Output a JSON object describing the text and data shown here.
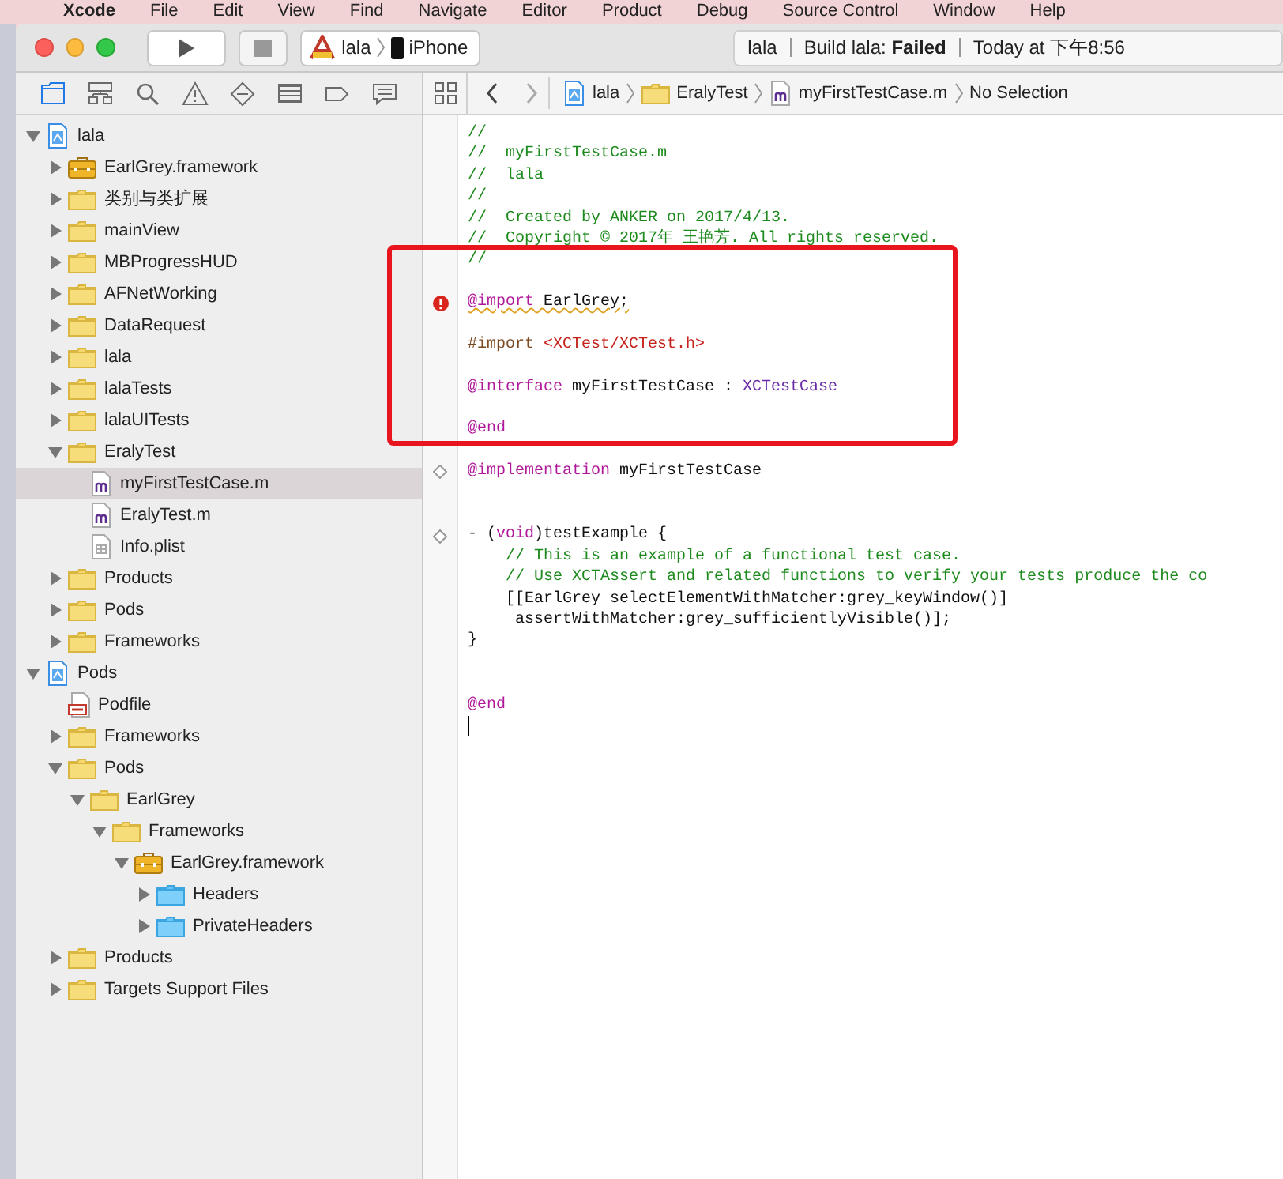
{
  "menu_bar": {
    "items": [
      "Xcode",
      "File",
      "Edit",
      "View",
      "Find",
      "Navigate",
      "Editor",
      "Product",
      "Debug",
      "Source Control",
      "Window",
      "Help"
    ]
  },
  "toolbar": {
    "scheme": {
      "target": "lala",
      "device": "iPhone"
    },
    "activity": {
      "project": "lala",
      "status_label": "Build lala: ",
      "status": "Failed",
      "time": "Today at 下午8:56"
    }
  },
  "navigator_tabs": [
    {
      "kind": "project",
      "selected": true
    },
    {
      "kind": "symbol",
      "selected": false
    },
    {
      "kind": "find",
      "selected": false
    },
    {
      "kind": "issue",
      "selected": false
    },
    {
      "kind": "test",
      "selected": false
    },
    {
      "kind": "debug",
      "selected": false
    },
    {
      "kind": "breakpoint",
      "selected": false
    },
    {
      "kind": "report",
      "selected": false
    }
  ],
  "tree": [
    {
      "label": "lala",
      "kind": "project",
      "expanded": true,
      "selected": false,
      "children": [
        {
          "label": "EarlGrey.framework",
          "kind": "framework",
          "expanded": false,
          "selected": false
        },
        {
          "label": "类别与类扩展",
          "kind": "folder",
          "expanded": false,
          "selected": false
        },
        {
          "label": "mainView",
          "kind": "folder",
          "expanded": false,
          "selected": false
        },
        {
          "label": "MBProgressHUD",
          "kind": "folder",
          "expanded": false,
          "selected": false
        },
        {
          "label": "AFNetWorking",
          "kind": "folder",
          "expanded": false,
          "selected": false
        },
        {
          "label": "DataRequest",
          "kind": "folder",
          "expanded": false,
          "selected": false
        },
        {
          "label": "lala",
          "kind": "folder",
          "expanded": false,
          "selected": false
        },
        {
          "label": "lalaTests",
          "kind": "folder",
          "expanded": false,
          "selected": false
        },
        {
          "label": "lalaUITests",
          "kind": "folder",
          "expanded": false,
          "selected": false
        },
        {
          "label": "EralyTest",
          "kind": "folder",
          "expanded": true,
          "selected": false,
          "children": [
            {
              "label": "myFirstTestCase.m",
              "kind": "m",
              "selected": true
            },
            {
              "label": "EralyTest.m",
              "kind": "m",
              "selected": false
            },
            {
              "label": "Info.plist",
              "kind": "plist",
              "selected": false
            }
          ]
        },
        {
          "label": "Products",
          "kind": "folder",
          "expanded": false,
          "selected": false
        },
        {
          "label": "Pods",
          "kind": "folder",
          "expanded": false,
          "selected": false
        },
        {
          "label": "Frameworks",
          "kind": "folder",
          "expanded": false,
          "selected": false
        }
      ]
    },
    {
      "label": "Pods",
      "kind": "project",
      "expanded": true,
      "selected": false,
      "children": [
        {
          "label": "Podfile",
          "kind": "podfile",
          "selected": false
        },
        {
          "label": "Frameworks",
          "kind": "folder",
          "expanded": false,
          "selected": false
        },
        {
          "label": "Pods",
          "kind": "folder",
          "expanded": true,
          "selected": false,
          "children": [
            {
              "label": "EarlGrey",
              "kind": "folder",
              "expanded": true,
              "selected": false,
              "children": [
                {
                  "label": "Frameworks",
                  "kind": "folder",
                  "expanded": true,
                  "selected": false,
                  "children": [
                    {
                      "label": "EarlGrey.framework",
                      "kind": "framework",
                      "expanded": true,
                      "selected": false,
                      "children": [
                        {
                          "label": "Headers",
                          "kind": "folder-blue",
                          "expanded": false,
                          "selected": false
                        },
                        {
                          "label": "PrivateHeaders",
                          "kind": "folder-blue",
                          "expanded": false,
                          "selected": false
                        }
                      ]
                    }
                  ]
                }
              ]
            }
          ]
        },
        {
          "label": "Products",
          "kind": "folder",
          "expanded": false,
          "selected": false
        },
        {
          "label": "Targets Support Files",
          "kind": "folder",
          "expanded": false,
          "selected": false
        }
      ]
    }
  ],
  "jump_bar": [
    {
      "label": "lala",
      "kind": "project"
    },
    {
      "label": "EralyTest",
      "kind": "folder"
    },
    {
      "label": "myFirstTestCase.m",
      "kind": "m"
    },
    {
      "label": "No Selection",
      "kind": "text"
    }
  ],
  "code_blocks": [
    {
      "boxed": false,
      "lines": [
        {
          "kind": "code",
          "segments": [
            {
              "kind": "comment",
              "text": "//"
            }
          ]
        },
        {
          "kind": "code",
          "segments": [
            {
              "kind": "comment",
              "text": "//  myFirstTestCase.m"
            }
          ]
        },
        {
          "kind": "code",
          "segments": [
            {
              "kind": "comment",
              "text": "//  lala"
            }
          ]
        },
        {
          "kind": "code",
          "segments": [
            {
              "kind": "comment",
              "text": "//"
            }
          ]
        },
        {
          "kind": "code",
          "segments": [
            {
              "kind": "comment",
              "text": "//  Created by ANKER on 2017/4/13."
            }
          ]
        },
        {
          "kind": "code",
          "segments": [
            {
              "kind": "comment",
              "text": "//  Copyright © 2017年 王艳芳. All rights reserved."
            }
          ]
        }
      ]
    },
    {
      "boxed": true,
      "lines": [
        {
          "kind": "code",
          "segments": [
            {
              "kind": "comment",
              "text": "//"
            }
          ]
        },
        {
          "kind": "blank"
        },
        {
          "kind": "code",
          "error": true,
          "squiggle": true,
          "segments": [
            {
              "kind": "keyword",
              "text": "@import"
            },
            {
              "kind": "plain",
              "text": " EarlGrey;"
            }
          ]
        },
        {
          "kind": "blank"
        },
        {
          "kind": "code",
          "segments": [
            {
              "kind": "preprocessor",
              "text": "#import "
            },
            {
              "kind": "string",
              "text": "<XCTest/XCTest.h>"
            }
          ]
        },
        {
          "kind": "blank"
        },
        {
          "kind": "code",
          "segments": [
            {
              "kind": "keyword",
              "text": "@interface"
            },
            {
              "kind": "plain",
              "text": " myFirstTestCase : "
            },
            {
              "kind": "class",
              "text": "XCTestCase"
            }
          ]
        },
        {
          "kind": "blank"
        },
        {
          "kind": "code",
          "segments": [
            {
              "kind": "keyword",
              "text": "@end"
            }
          ]
        }
      ]
    },
    {
      "boxed": false,
      "lines": [
        {
          "kind": "blank"
        },
        {
          "kind": "code",
          "test_diamond": true,
          "segments": [
            {
              "kind": "keyword",
              "text": "@implementation"
            },
            {
              "kind": "plain",
              "text": " myFirstTestCase"
            }
          ]
        },
        {
          "kind": "blank"
        },
        {
          "kind": "blank"
        },
        {
          "kind": "code",
          "test_diamond": true,
          "segments": [
            {
              "kind": "plain",
              "text": "- ("
            },
            {
              "kind": "keyword",
              "text": "void"
            },
            {
              "kind": "plain",
              "text": ")testExample {"
            }
          ]
        },
        {
          "kind": "code",
          "segments": [
            {
              "kind": "comment",
              "text": "    // This is an example of a functional test case."
            }
          ]
        },
        {
          "kind": "code",
          "segments": [
            {
              "kind": "comment",
              "text": "    // Use XCTAssert and related functions to verify your tests produce the co"
            }
          ]
        },
        {
          "kind": "code",
          "segments": [
            {
              "kind": "plain",
              "text": "    [[EarlGrey selectElementWithMatcher:grey_keyWindow()]"
            }
          ]
        },
        {
          "kind": "code",
          "segments": [
            {
              "kind": "plain",
              "text": "     assertWithMatcher:grey_sufficientlyVisible()];"
            }
          ]
        },
        {
          "kind": "code",
          "segments": [
            {
              "kind": "plain",
              "text": "}"
            }
          ]
        },
        {
          "kind": "blank"
        },
        {
          "kind": "blank"
        },
        {
          "kind": "code",
          "segments": [
            {
              "kind": "keyword",
              "text": "@end"
            }
          ]
        },
        {
          "kind": "cursor"
        }
      ]
    }
  ]
}
